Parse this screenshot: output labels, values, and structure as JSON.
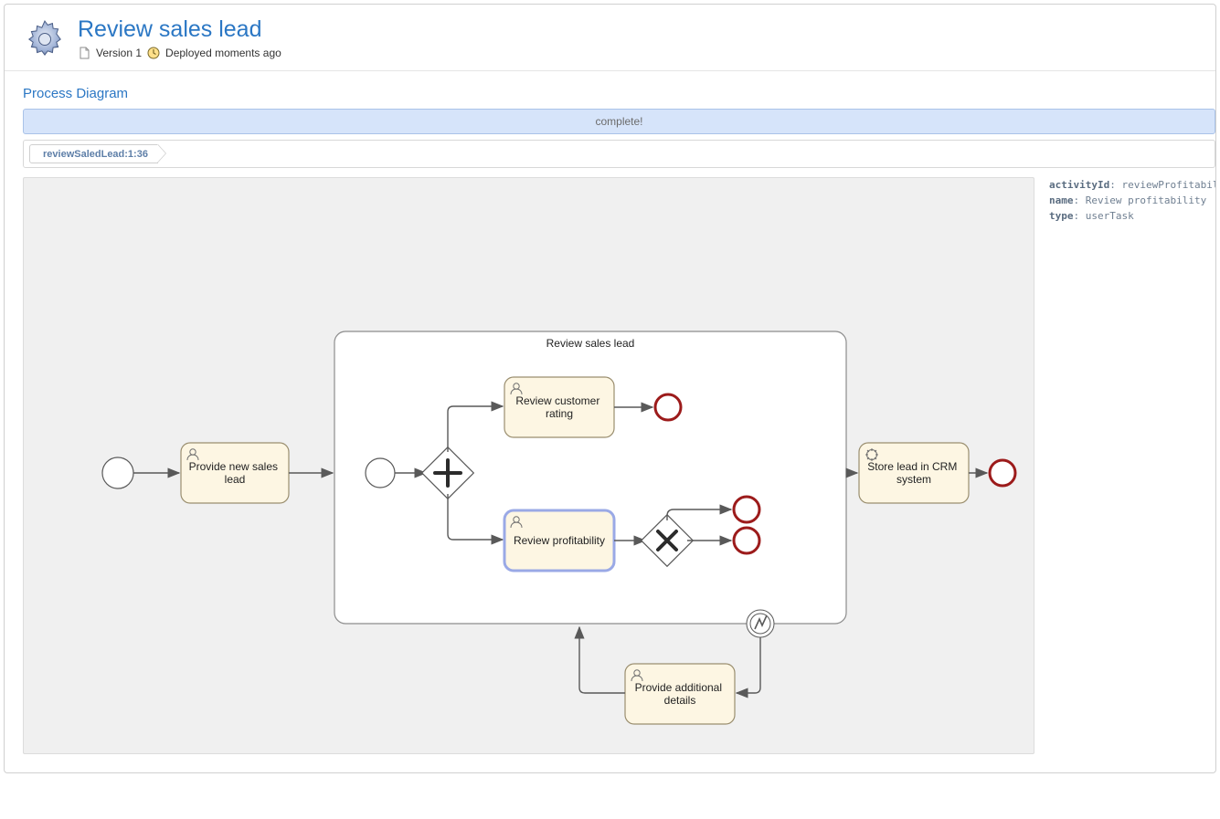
{
  "header": {
    "title": "Review sales lead",
    "version_label": "Version 1",
    "deployed_label": "Deployed moments ago"
  },
  "section_title": "Process Diagram",
  "status_bar": "complete!",
  "breadcrumb": {
    "items": [
      "reviewSaledLead:1:36"
    ]
  },
  "meta": {
    "activityId_label": "activityId",
    "activityId_value": "reviewProfitability",
    "name_label": "name",
    "name_value": "Review profitability",
    "type_label": "type",
    "type_value": "userTask"
  },
  "diagram": {
    "pool_label": "Review sales lead",
    "tasks": {
      "provide_new_sales_lead": "Provide new sales\nlead",
      "review_customer_rating": "Review customer\nrating",
      "review_profitability": "Review profitability",
      "provide_additional_details": "Provide additional\ndetails",
      "store_lead_in_crm": "Store lead in CRM\nsystem"
    }
  }
}
